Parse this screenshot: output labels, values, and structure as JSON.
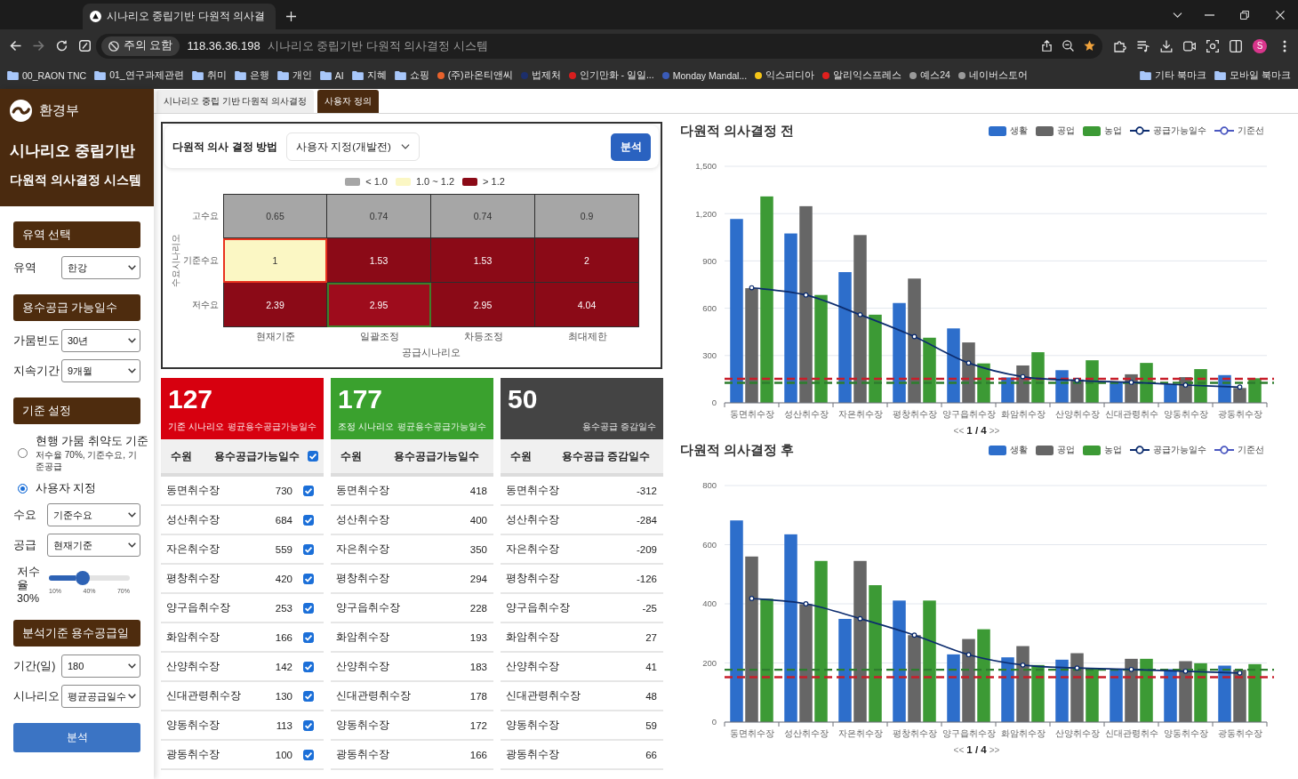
{
  "browser": {
    "tabs": [
      {
        "title": "시나리오 중립기반 다원적 의사결",
        "selected": true
      }
    ],
    "address": {
      "security": "주의 요함",
      "url": "118.36.36.198",
      "page_title": "시나리오 중립기반 다원적 의사결정 시스템"
    },
    "profile": "S",
    "bookmarks": [
      {
        "label": "00_RAON TNC",
        "kind": "folder"
      },
      {
        "label": "01_연구과제관련",
        "kind": "folder"
      },
      {
        "label": "취미",
        "kind": "folder"
      },
      {
        "label": "은행",
        "kind": "folder"
      },
      {
        "label": "개인",
        "kind": "folder"
      },
      {
        "label": "AI",
        "kind": "folder"
      },
      {
        "label": "지혜",
        "kind": "folder"
      },
      {
        "label": "쇼핑",
        "kind": "folder"
      },
      {
        "label": "(주)라온티앤씨",
        "kind": "site",
        "color": "#e8622c"
      },
      {
        "label": "법제처",
        "kind": "site",
        "color": "#1d2f6b"
      },
      {
        "label": "인기만화 - 일일...",
        "kind": "site",
        "color": "#d81e1e"
      },
      {
        "label": "Monday Mandal...",
        "kind": "site",
        "color": "#3a5bb8"
      },
      {
        "label": "익스피디아",
        "kind": "site",
        "color": "#f5c518"
      },
      {
        "label": "알리익스프레스",
        "kind": "site",
        "color": "#e0201e"
      },
      {
        "label": "예스24",
        "kind": "site",
        "color": "#9a9a9a"
      },
      {
        "label": "네이버스토어",
        "kind": "site",
        "color": "#9a9a9a"
      }
    ],
    "other_bookmarks": [
      {
        "label": "기타 북마크",
        "kind": "folder"
      },
      {
        "label": "모바일 북마크",
        "kind": "folder"
      }
    ]
  },
  "sidebar": {
    "org": "환경부",
    "title": "시나리오 중립기반",
    "subtitle": "다원적 의사결정 시스템",
    "sections": [
      {
        "title": "유역 선택",
        "controls": [
          {
            "kind": "select",
            "label": "유역",
            "value": "한강"
          }
        ]
      },
      {
        "title": "용수공급 가능일수",
        "controls": [
          {
            "kind": "select",
            "label": "가뭄빈도",
            "value": "30년"
          },
          {
            "kind": "select",
            "label": "지속기간",
            "value": "9개월"
          }
        ]
      },
      {
        "title": "기준 설정",
        "controls": [
          {
            "kind": "radio",
            "label": "현행 가뭄 취약도 기준",
            "note": "저수율 70%, 기준수요, 기준공급",
            "selected": false
          },
          {
            "kind": "radio",
            "label": "사용자 지정",
            "selected": true
          },
          {
            "kind": "select",
            "label": "수요",
            "value": "기준수요"
          },
          {
            "kind": "select",
            "label": "공급",
            "value": "현재기준"
          },
          {
            "kind": "slider",
            "label": "저수율",
            "reading": "30%",
            "level": 0.33,
            "ticks": [
              "10%",
              "40%",
              "70%"
            ]
          }
        ]
      },
      {
        "title": "분석기준 용수공급일",
        "controls": [
          {
            "kind": "select",
            "label": "기간(일)",
            "value": "180"
          },
          {
            "kind": "select",
            "label": "시나리오",
            "value": "평균공급일수"
          }
        ]
      }
    ],
    "button": "분석"
  },
  "tabs": [
    {
      "label": "시나리오 중립 기반 다원적 의사결정",
      "selected": false
    },
    {
      "label": "사용자 정의",
      "selected": true
    }
  ],
  "decision_panel": {
    "label": "다원적 의사 결정 방법",
    "method": "사용자 지정(개발전)",
    "button": "분석",
    "legend": [
      {
        "label": "< 1.0",
        "color": "#a6a6a6"
      },
      {
        "label": "1.0 ~ 1.2",
        "color": "#fbf7c4"
      },
      {
        "label": "> 1.2",
        "color": "#8b0a17"
      }
    ],
    "y_axis_title": "수요시나리오",
    "rows": [
      {
        "label": "고수요",
        "cells": [
          {
            "value": "0.65",
            "color": "#a6a6a6",
            "kind": "plain"
          },
          {
            "value": "0.74",
            "color": "#a6a6a6",
            "kind": "plain"
          },
          {
            "value": "0.74",
            "color": "#a6a6a6",
            "kind": "plain"
          },
          {
            "value": "0.9",
            "color": "#a6a6a6",
            "kind": "plain"
          }
        ]
      },
      {
        "label": "기준수요",
        "cells": [
          {
            "value": "1",
            "color": "#fbf7c4",
            "kind": "base"
          },
          {
            "value": "1.53",
            "color": "#8b0a17",
            "kind": "plain"
          },
          {
            "value": "1.53",
            "color": "#8b0a17",
            "kind": "plain"
          },
          {
            "value": "2",
            "color": "#8b0a17",
            "kind": "plain"
          }
        ]
      },
      {
        "label": "저수요",
        "cells": [
          {
            "value": "2.39",
            "color": "#8b0a17",
            "kind": "plain"
          },
          {
            "value": "2.95",
            "color": "#9e0c1c",
            "kind": "adjusted"
          },
          {
            "value": "2.95",
            "color": "#8b0a17",
            "kind": "plain"
          },
          {
            "value": "4.04",
            "color": "#8b0a17",
            "kind": "plain"
          }
        ]
      }
    ],
    "x_axis_labels": [
      "현재기준",
      "일괄조정",
      "차등조정",
      "최대제한"
    ],
    "x_axis_title": "공급시나리오"
  },
  "summary": [
    {
      "value": "127",
      "caption": "기준 시나리오",
      "label": "평균용수공급가능일수",
      "color": "#d7000f",
      "columns": [
        "수원",
        "용수공급가능일수"
      ],
      "header_checked": true,
      "rows": [
        {
          "name": "동면취수장",
          "value": "730",
          "checked": true
        },
        {
          "name": "성산취수장",
          "value": "684",
          "checked": true
        },
        {
          "name": "자은취수장",
          "value": "559",
          "checked": true
        },
        {
          "name": "평창취수장",
          "value": "420",
          "checked": true
        },
        {
          "name": "양구읍취수장",
          "value": "253",
          "checked": true
        },
        {
          "name": "화암취수장",
          "value": "166",
          "checked": true
        },
        {
          "name": "산양취수장",
          "value": "142",
          "checked": true
        },
        {
          "name": "신대관령취수장",
          "value": "130",
          "checked": true
        },
        {
          "name": "양동취수장",
          "value": "113",
          "checked": true
        },
        {
          "name": "광동취수장",
          "value": "100",
          "checked": true
        }
      ]
    },
    {
      "value": "177",
      "caption": "조정 시나리오",
      "label": "평균용수공급가능일수",
      "color": "#3aa12e",
      "columns": [
        "수원",
        "용수공급가능일수"
      ],
      "rows": [
        {
          "name": "동면취수장",
          "value": "418"
        },
        {
          "name": "성산취수장",
          "value": "400"
        },
        {
          "name": "자은취수장",
          "value": "350"
        },
        {
          "name": "평창취수장",
          "value": "294"
        },
        {
          "name": "양구읍취수장",
          "value": "228"
        },
        {
          "name": "화암취수장",
          "value": "193"
        },
        {
          "name": "산양취수장",
          "value": "183"
        },
        {
          "name": "신대관령취수장",
          "value": "178"
        },
        {
          "name": "양동취수장",
          "value": "172"
        },
        {
          "name": "광동취수장",
          "value": "166"
        }
      ]
    },
    {
      "value": "50",
      "label": "용수공급 증감일수",
      "color": "#444444",
      "columns": [
        "수원",
        "용수공급 증감일수"
      ],
      "rows": [
        {
          "name": "동면취수장",
          "value": "-312"
        },
        {
          "name": "성산취수장",
          "value": "-284"
        },
        {
          "name": "자은취수장",
          "value": "-209"
        },
        {
          "name": "평창취수장",
          "value": "-126"
        },
        {
          "name": "양구읍취수장",
          "value": "-25"
        },
        {
          "name": "화암취수장",
          "value": "27"
        },
        {
          "name": "산양취수장",
          "value": "41"
        },
        {
          "name": "신대관령취수장",
          "value": "48"
        },
        {
          "name": "양동취수장",
          "value": "59"
        },
        {
          "name": "광동취수장",
          "value": "66"
        }
      ]
    }
  ],
  "charts": [
    {
      "chart_data": {
        "type": "bar",
        "title": "다원적 의사결정 전",
        "categories": [
          "동면취수장",
          "성산취수장",
          "자은취수장",
          "평창취수장",
          "양구읍취수장",
          "화암취수장",
          "산양취수장",
          "신대관령취수",
          "양동취수장",
          "광동취수장"
        ],
        "series": [
          {
            "name": "생활",
            "type": "bar",
            "color": "#2d6ecb",
            "values": [
              1166,
              1074,
              829,
              633,
              472,
              161,
              207,
              135,
              117,
              176
            ]
          },
          {
            "name": "공업",
            "type": "bar",
            "color": "#666666",
            "values": [
              727,
              1247,
              1064,
              788,
              383,
              237,
              148,
              181,
              163,
              94
            ]
          },
          {
            "name": "농업",
            "type": "bar",
            "color": "#3c9a35",
            "values": [
              1309,
              684,
              559,
              413,
              250,
              321,
              270,
              253,
              214,
              156
            ]
          },
          {
            "name": "공급가능일수",
            "type": "line",
            "color": "#0c2c6e",
            "marker": "circle",
            "values": [
              730,
              684,
              559,
              420,
              253,
              166,
              142,
              130,
              113,
              100
            ]
          }
        ],
        "ylim": [
          0,
          1500
        ],
        "yticks": [
          0,
          300,
          600,
          900,
          {
            "value": 1200,
            "label": "1,200"
          },
          {
            "value": 1500,
            "label": "1,500"
          }
        ],
        "grid": true,
        "legend": "upper right",
        "ref_lines": [
          {
            "axis": "y",
            "value": 152,
            "color": "#c81e2a"
          },
          {
            "axis": "y",
            "value": 127,
            "color": "#2e7d2e"
          }
        ]
      },
      "legend_extra": [
        {
          "label": "기준선",
          "kind": "line",
          "color": "#4a57c0"
        }
      ],
      "pager": {
        "prev": "<<",
        "page": "1 / 4",
        "next": ">>"
      }
    },
    {
      "chart_data": {
        "type": "bar",
        "title": "다원적 의사결정 후",
        "categories": [
          "동면취수장",
          "성산취수장",
          "자은취수장",
          "평창취수장",
          "양구읍취수장",
          "화암취수장",
          "산양취수장",
          "신대관령취수",
          "양동취수장",
          "광동취수장"
        ],
        "series": [
          {
            "name": "생활",
            "type": "bar",
            "color": "#2d6ecb",
            "values": [
              682,
              635,
              349,
              411,
              229,
              219,
              211,
              179,
              179,
              191
            ]
          },
          {
            "name": "공업",
            "type": "bar",
            "color": "#666666",
            "values": [
              560,
              399,
              545,
              294,
              281,
              257,
              233,
              214,
              206,
              177
            ]
          },
          {
            "name": "농업",
            "type": "bar",
            "color": "#3c9a35",
            "values": [
              417,
              545,
              463,
              411,
              314,
              193,
              181,
              214,
              199,
              196
            ]
          },
          {
            "name": "공급가능일수",
            "type": "line",
            "color": "#0c2c6e",
            "marker": "circle",
            "values": [
              418,
              400,
              350,
              294,
              228,
              193,
              183,
              178,
              172,
              166
            ]
          }
        ],
        "ylim": [
          0,
          800
        ],
        "yticks": [
          0,
          200,
          400,
          600,
          800
        ],
        "grid": true,
        "legend": "upper right",
        "ref_lines": [
          {
            "axis": "y",
            "value": 177,
            "color": "#2e7d2e"
          },
          {
            "axis": "y",
            "value": 152,
            "color": "#c81e2a"
          }
        ]
      },
      "legend_extra": [
        {
          "label": "기준선",
          "kind": "line",
          "color": "#4a57c0"
        }
      ],
      "pager": {
        "prev": "<<",
        "page": "1 / 4",
        "next": ">>"
      }
    }
  ]
}
